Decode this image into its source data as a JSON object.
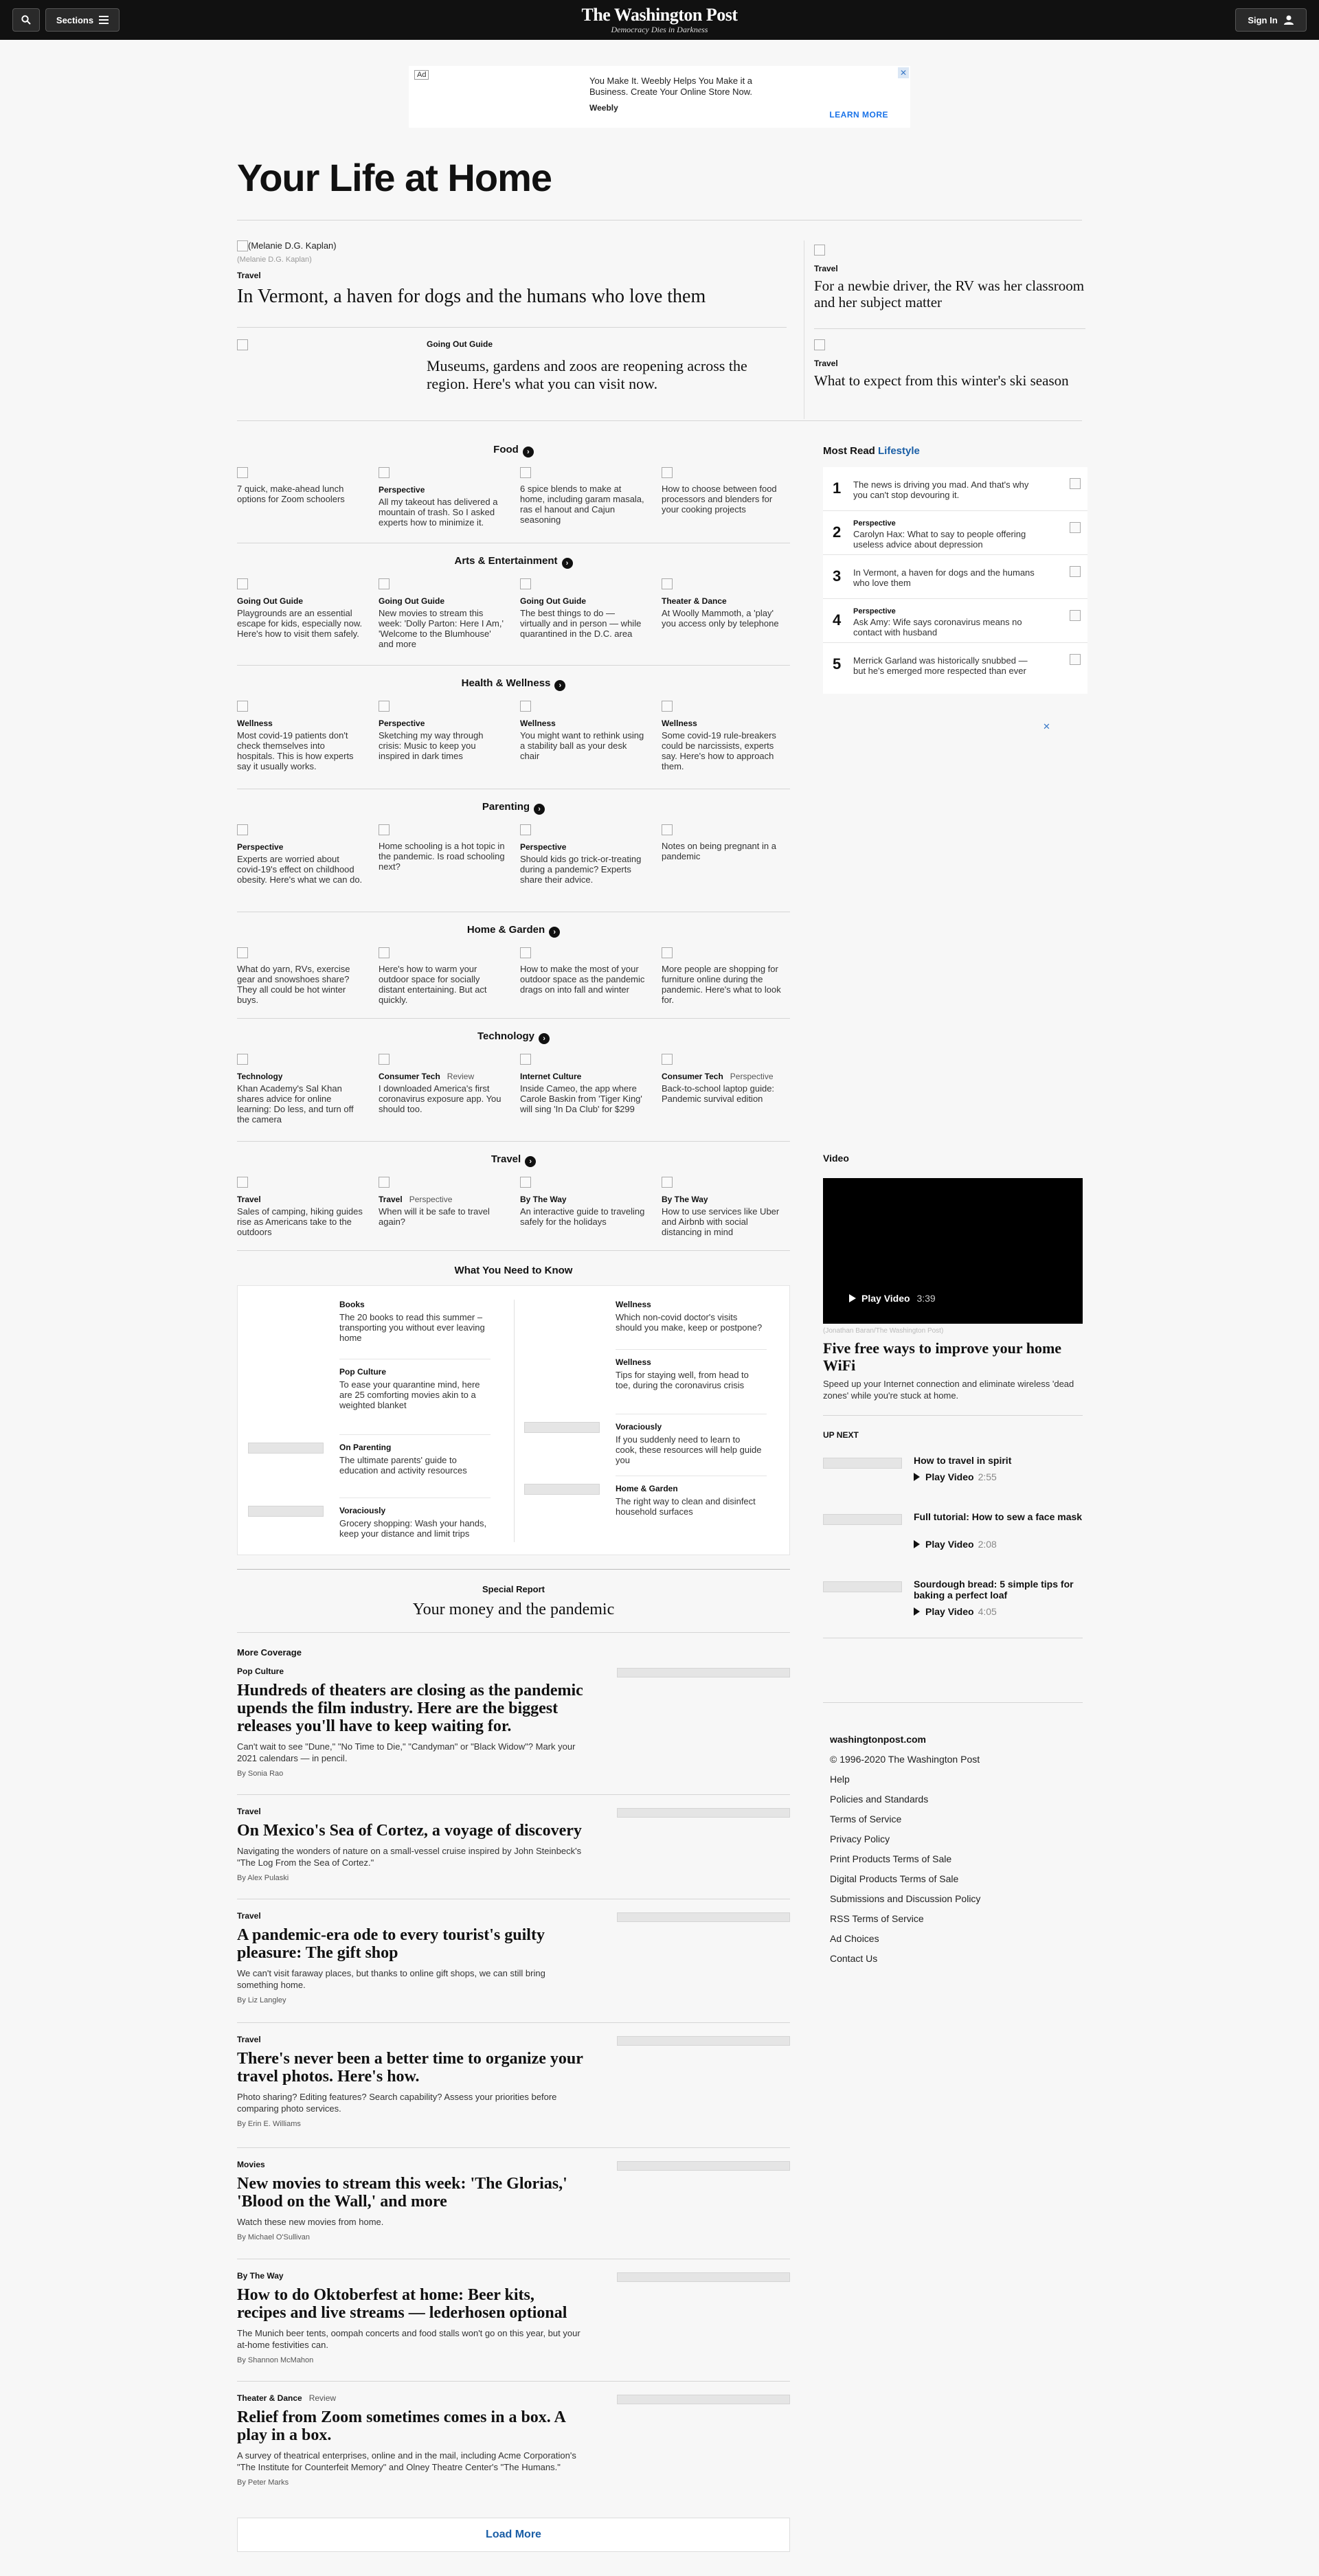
{
  "header": {
    "sections_label": "Sections",
    "logo": "The Washington Post",
    "tagline": "Democracy Dies in Darkness",
    "signin_label": "Sign In"
  },
  "ad": {
    "label": "Ad",
    "text": "You Make It. Weebly Helps You Make it a Business. Create Your Online Store Now.",
    "brand": "Weebly",
    "cta": "LEARN MORE",
    "close": "✕"
  },
  "page_title": "Your Life at Home",
  "top": {
    "lead": {
      "img_alt": "(Melanie D.G. Kaplan)",
      "credit": "(Melanie D.G. Kaplan)",
      "kicker": "Travel",
      "headline": "In Vermont, a haven for dogs and the humans who love them"
    },
    "second": {
      "kicker": "Going Out Guide",
      "headline": "Museums, gardens and zoos are reopening across the region. Here's what you can visit now."
    },
    "right": [
      {
        "kicker": "Travel",
        "headline": "For a newbie driver, the RV was her classroom and her subject matter"
      },
      {
        "kicker": "Travel",
        "headline": "What to expect from this winter's ski season"
      }
    ]
  },
  "sections": [
    {
      "title": "Food",
      "items": [
        {
          "kicker": "",
          "sub": "",
          "text": "7 quick, make-ahead lunch options for Zoom schoolers"
        },
        {
          "kicker": "Perspective",
          "sub": "",
          "text": "All my takeout has delivered a mountain of trash. So I asked experts how to minimize it."
        },
        {
          "kicker": "",
          "sub": "",
          "text": "6 spice blends to make at home, including garam masala, ras el hanout and Cajun seasoning"
        },
        {
          "kicker": "",
          "sub": "",
          "text": "How to choose between food processors and blenders for your cooking projects"
        }
      ]
    },
    {
      "title": "Arts & Entertainment",
      "items": [
        {
          "kicker": "Going Out Guide",
          "sub": "",
          "text": "Playgrounds are an essential escape for kids, especially now. Here's how to visit them safely."
        },
        {
          "kicker": "Going Out Guide",
          "sub": "",
          "text": "New movies to stream this week: 'Dolly Parton: Here I Am,' 'Welcome to the Blumhouse' and more"
        },
        {
          "kicker": "Going Out Guide",
          "sub": "",
          "text": "The best things to do — virtually and in person — while quarantined in the D.C. area"
        },
        {
          "kicker": "Theater & Dance",
          "sub": "",
          "text": "At Woolly Mammoth, a 'play' you access only by telephone"
        }
      ]
    },
    {
      "title": "Health & Wellness",
      "items": [
        {
          "kicker": "Wellness",
          "sub": "",
          "text": "Most covid-19 patients don't check themselves into hospitals. This is how experts say it usually works."
        },
        {
          "kicker": "Perspective",
          "sub": "",
          "text": "Sketching my way through crisis: Music to keep you inspired in dark times"
        },
        {
          "kicker": "Wellness",
          "sub": "",
          "text": "You might want to rethink using a stability ball as your desk chair"
        },
        {
          "kicker": "Wellness",
          "sub": "",
          "text": "Some covid-19 rule-breakers could be narcissists, experts say. Here's how to approach them."
        }
      ]
    },
    {
      "title": "Parenting",
      "items": [
        {
          "kicker": "Perspective",
          "sub": "",
          "text": "Experts are worried about covid-19's effect on childhood obesity. Here's what we can do."
        },
        {
          "kicker": "",
          "sub": "",
          "text": "Home schooling is a hot topic in the pandemic. Is road schooling next?"
        },
        {
          "kicker": "Perspective",
          "sub": "",
          "text": "Should kids go trick-or-treating during a pandemic? Experts share their advice."
        },
        {
          "kicker": "",
          "sub": "",
          "text": "Notes on being pregnant in a pandemic"
        }
      ]
    },
    {
      "title": "Home & Garden",
      "items": [
        {
          "kicker": "",
          "sub": "",
          "text": "What do yarn, RVs, exercise gear and snowshoes share? They all could be hot winter buys."
        },
        {
          "kicker": "",
          "sub": "",
          "text": "Here's how to warm your outdoor space for socially distant entertaining. But act quickly."
        },
        {
          "kicker": "",
          "sub": "",
          "text": "How to make the most of your outdoor space as the pandemic drags on into fall and winter"
        },
        {
          "kicker": "",
          "sub": "",
          "text": "More people are shopping for furniture online during the pandemic. Here's what to look for."
        }
      ]
    },
    {
      "title": "Technology",
      "items": [
        {
          "kicker": "Technology",
          "sub": "",
          "text": "Khan Academy's Sal Khan shares advice for online learning: Do less, and turn off the camera"
        },
        {
          "kicker": "Consumer Tech",
          "sub": "Review",
          "text": "I downloaded America's first coronavirus exposure app. You should too."
        },
        {
          "kicker": "Internet Culture",
          "sub": "",
          "text": "Inside Cameo, the app where Carole Baskin from 'Tiger King' will sing 'In Da Club' for $299"
        },
        {
          "kicker": "Consumer Tech",
          "sub": "Perspective",
          "text": "Back-to-school laptop guide: Pandemic survival edition"
        }
      ]
    },
    {
      "title": "Travel",
      "items": [
        {
          "kicker": "Travel",
          "sub": "",
          "text": "Sales of camping, hiking guides rise as Americans take to the outdoors"
        },
        {
          "kicker": "Travel",
          "sub": "Perspective",
          "text": "When will it be safe to travel again?"
        },
        {
          "kicker": "By The Way",
          "sub": "",
          "text": "An interactive guide to traveling safely for the holidays"
        },
        {
          "kicker": "By The Way",
          "sub": "",
          "text": "How to use services like Uber and Airbnb with social distancing in mind"
        }
      ]
    }
  ],
  "most_read": {
    "title": "Most Read",
    "title_accent": "Lifestyle",
    "items": [
      {
        "num": "1",
        "kicker": "",
        "text": "The news is driving you mad. And that's why you can't stop devouring it."
      },
      {
        "num": "2",
        "kicker": "Perspective",
        "text": "Carolyn Hax: What to say to people offering useless advice about depression"
      },
      {
        "num": "3",
        "kicker": "",
        "text": "In Vermont, a haven for dogs and the humans who love them"
      },
      {
        "num": "4",
        "kicker": "Perspective",
        "text": "Ask Amy: Wife says coronavirus means no contact with husband"
      },
      {
        "num": "5",
        "kicker": "",
        "text": "Merrick Garland was historically snubbed — but he's emerged more respected than ever"
      }
    ]
  },
  "video": {
    "label": "Video",
    "play": "Play Video",
    "duration": "3:39",
    "credit": "(Jonathan Baran/The Washington Post)",
    "title": "Five free ways to improve your home WiFi",
    "desc": "Speed up your Internet connection and eliminate wireless 'dead zones' while you're stuck at home.",
    "up_next_label": "UP NEXT",
    "up_next": [
      {
        "title": "How to travel in spirit",
        "play": "Play Video",
        "duration": "2:55"
      },
      {
        "title": "Full tutorial: How to sew a face mask",
        "play": "Play Video",
        "duration": "2:08"
      },
      {
        "title": "Sourdough bread: 5 simple tips for baking a perfect loaf",
        "play": "Play Video",
        "duration": "4:05"
      }
    ]
  },
  "footer": {
    "site": "washingtonpost.com",
    "copyright": "© 1996-2020 The Washington Post",
    "links": [
      "Help",
      "Policies and Standards",
      "Terms of Service",
      "Privacy Policy",
      "Print Products Terms of Sale",
      "Digital Products Terms of Sale",
      "Submissions and Discussion Policy",
      "RSS Terms of Service",
      "Ad Choices",
      "Contact Us"
    ]
  },
  "wyntk": {
    "title": "What You Need to Know",
    "left": [
      {
        "kicker": "Books",
        "text": "The 20 books to read this summer – transporting you without ever leaving home"
      },
      {
        "kicker": "Pop Culture",
        "text": "To ease your quarantine mind, here are 25 comforting movies akin to a weighted blanket"
      },
      {
        "kicker": "On Parenting",
        "text": "The ultimate parents' guide to education and activity resources"
      },
      {
        "kicker": "Voraciously",
        "text": "Grocery shopping: Wash your hands, keep your distance and limit trips"
      }
    ],
    "right": [
      {
        "kicker": "Wellness",
        "text": "Which non-covid doctor's visits should you make, keep or postpone?"
      },
      {
        "kicker": "Wellness",
        "text": "Tips for staying well, from head to toe, during the coronavirus crisis"
      },
      {
        "kicker": "Voraciously",
        "text": "If you suddenly need to learn to cook, these resources will help guide you"
      },
      {
        "kicker": "Home & Garden",
        "text": "The right way to clean and disinfect household surfaces"
      }
    ]
  },
  "special_report": {
    "label": "Special Report",
    "title": "Your money and the pandemic"
  },
  "more_coverage": {
    "title": "More Coverage",
    "items": [
      {
        "kicker": "Pop Culture",
        "sub": "",
        "headline": "Hundreds of theaters are closing as the pandemic upends the film industry. Here are the biggest releases you'll have to keep waiting for.",
        "desc": "Can't wait to see \"Dune,\" \"No Time to Die,\" \"Candyman\" or \"Black Widow\"? Mark your 2021 calendars — in pencil.",
        "byline": "By Sonia Rao"
      },
      {
        "kicker": "Travel",
        "sub": "",
        "headline": "On Mexico's Sea of Cortez, a voyage of discovery",
        "desc": "Navigating the wonders of nature on a small-vessel cruise inspired by John Steinbeck's \"The Log From the Sea of Cortez.\"",
        "byline": "By Alex Pulaski"
      },
      {
        "kicker": "Travel",
        "sub": "",
        "headline": "A pandemic-era ode to every tourist's guilty pleasure: The gift shop",
        "desc": "We can't visit faraway places, but thanks to online gift shops, we can still bring something home.",
        "byline": "By Liz Langley"
      },
      {
        "kicker": "Travel",
        "sub": "",
        "headline": "There's never been a better time to organize your travel photos. Here's how.",
        "desc": "Photo sharing? Editing features? Search capability? Assess your priorities before comparing photo services.",
        "byline": "By Erin E. Williams"
      },
      {
        "kicker": "Movies",
        "sub": "",
        "headline": "New movies to stream this week: 'The Glorias,' 'Blood on the Wall,' and more",
        "desc": "Watch these new movies from home.",
        "byline": "By Michael O'Sullivan"
      },
      {
        "kicker": "By The Way",
        "sub": "",
        "headline": "How to do Oktoberfest at home: Beer kits, recipes and live streams — lederhosen optional",
        "desc": "The Munich beer tents, oompah concerts and food stalls won't go on this year, but your at-home festivities can.",
        "byline": "By Shannon McMahon"
      },
      {
        "kicker": "Theater & Dance",
        "sub": "Review",
        "headline": "Relief from Zoom sometimes comes in a box. A play in a box.",
        "desc": "A survey of theatrical enterprises, online and in the mail, including Acme Corporation's \"The Institute for Counterfeit Memory\" and Olney Theatre Center's \"The Humans.\"",
        "byline": "By Peter Marks"
      }
    ]
  },
  "load_more": "Load More"
}
